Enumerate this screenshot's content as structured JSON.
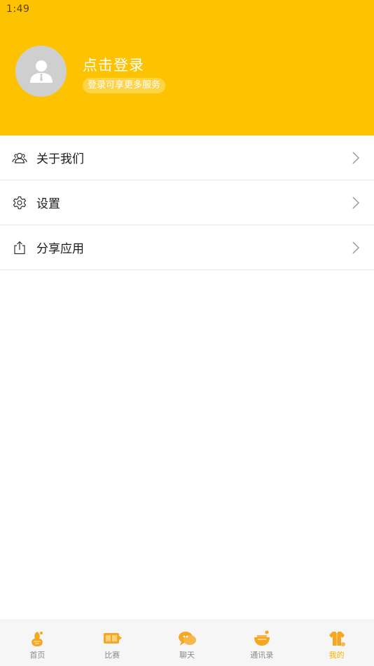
{
  "status_bar": {
    "time": "1:49"
  },
  "profile": {
    "title": "点击登录",
    "subtitle": "登录可享更多服务"
  },
  "menu": [
    {
      "label": "关于我们",
      "icon": "people-icon"
    },
    {
      "label": "设置",
      "icon": "gear-icon"
    },
    {
      "label": "分享应用",
      "icon": "share-icon"
    }
  ],
  "tabs": [
    {
      "label": "首页",
      "icon": "home-icon"
    },
    {
      "label": "比赛",
      "icon": "match-icon"
    },
    {
      "label": "聊天",
      "icon": "chat-icon"
    },
    {
      "label": "通讯录",
      "icon": "contacts-icon"
    },
    {
      "label": "我的",
      "icon": "profile-icon",
      "active": true
    }
  ],
  "colors": {
    "header_bg": "#fdc300",
    "active_tab": "#f4b400",
    "tab_icon_orange": "#f5a623"
  }
}
